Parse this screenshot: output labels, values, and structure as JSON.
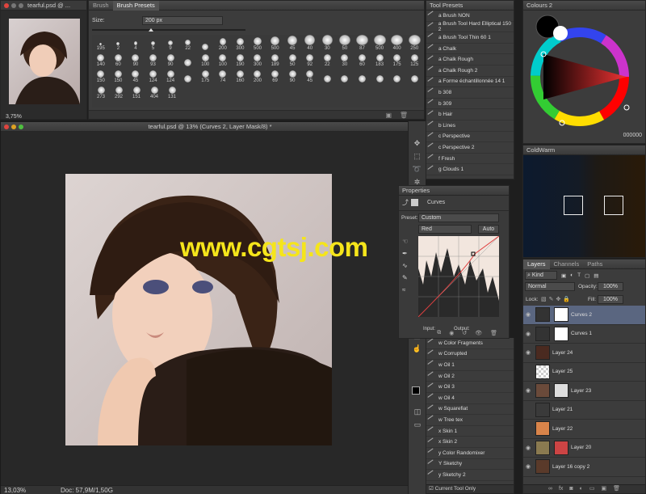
{
  "nav_window": {
    "title": "tearful.psd @ ...",
    "zoom": "3,75%"
  },
  "brush_panel": {
    "tabs": [
      "Brush",
      "Brush Presets"
    ],
    "size_label": "Size:",
    "size_value": "200 px",
    "row1": [
      "195",
      "2",
      "4",
      "5",
      "9",
      "22",
      "",
      "200",
      "300",
      "500",
      "500",
      "45",
      "40",
      "30",
      "50",
      "87",
      "500",
      "400",
      "250"
    ],
    "row2": [
      "140",
      "60",
      "90",
      "93",
      "90",
      "",
      "100",
      "100",
      "190",
      "300",
      "189",
      "50",
      "92",
      "22",
      "30",
      "60",
      "183",
      "175",
      "125"
    ],
    "row3": [
      "150",
      "150",
      "45",
      "124",
      "124",
      "",
      "175",
      "74",
      "160",
      "200",
      "69",
      "90",
      "45",
      "",
      "",
      "",
      "",
      "",
      ""
    ],
    "row4": [
      "273",
      "292",
      "151",
      "404",
      "131"
    ]
  },
  "tool_presets": {
    "title": "Tool Presets",
    "items": [
      "a Brush NON",
      "a Brush Tool Hard Elliptical 150 2",
      "a Brush Tool Thin 60 1",
      "a Chalk",
      "a Chalk Rough",
      "a Chalk Rough 2",
      "a Forme échantillonnée 14 1",
      "b 308",
      "b 309",
      "b Hair",
      "b Lines",
      "c Perspective",
      "c Perspective 2",
      "f Fresh",
      "g Clouds 1"
    ],
    "items_lower": [
      "w Color Fragments",
      "w Corrupted",
      "w Oil 1",
      "w Oil 2",
      "w Oil 3",
      "w Oil 4",
      "w Squarefiat",
      "w Tree tex",
      "x Skin 1",
      "x Skin 2",
      "y Color Randomixer",
      "Y Sketchy",
      "y Sketchy 2"
    ],
    "footer": "Current Tool Only"
  },
  "document": {
    "title": "tearful.psd @ 13% (Curves 2, Layer Mask/8) *",
    "zoom": "13,03%",
    "doc_size": "Doc: 57,9M/1,50G"
  },
  "watermark": "www.cgtsj.com",
  "properties": {
    "title": "Properties",
    "adjustment": "Curves",
    "preset_label": "Preset:",
    "preset_value": "Custom",
    "channel": "Red",
    "auto_label": "Auto",
    "input_label": "Input:",
    "output_label": "Output:"
  },
  "colours": {
    "title": "Colours 2",
    "hex_display": "000000"
  },
  "coldwarm": {
    "title": "ColdWarm"
  },
  "layers": {
    "tabs": [
      "Layers",
      "Channels",
      "Paths"
    ],
    "kind_label": "Kind",
    "blend_mode": "Normal",
    "opacity_label": "Opacity:",
    "opacity_value": "100%",
    "lock_label": "Lock:",
    "fill_label": "Fill:",
    "fill_value": "100%",
    "items": [
      "Curves 2",
      "Curves 1",
      "Layer 24",
      "Layer 25",
      "Layer 23",
      "Layer 21",
      "Layer 22",
      "Layer 20",
      "Layer 16 copy 2"
    ]
  },
  "colors": {
    "panel_bg": "#3c3c3c",
    "selected_layer": "#5a6680",
    "watermark": "#f5e51b"
  }
}
